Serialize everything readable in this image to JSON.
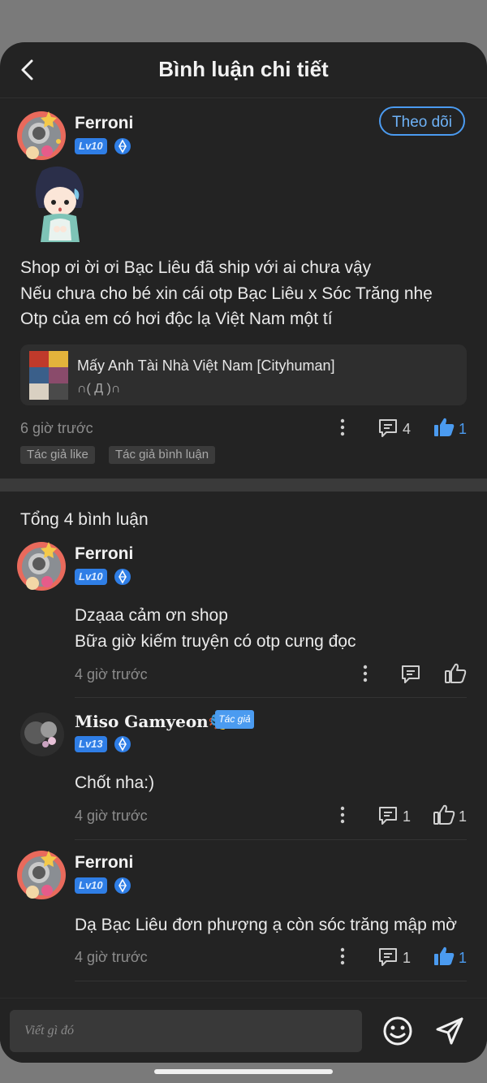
{
  "header": {
    "title": "Bình luận chi tiết"
  },
  "post": {
    "author": "Ferroni",
    "level": "Lv10",
    "follow_label": "Theo dõi",
    "lines": [
      "Shop ơi ời ơi Bạc Liêu đã ship với ai chưa vậy",
      "Nếu chưa cho bé xin cái otp Bạc Liêu x Sóc Trăng nhẹ",
      "Otp của em có hơi độc lạ Việt Nam một tí"
    ],
    "link": {
      "title": "Mấy Anh Tài Nhà Việt Nam [Cityhuman]",
      "subtitle": "∩( Д )∩"
    },
    "time": "6 giờ trước",
    "comment_count": "4",
    "like_count": "1",
    "tags": [
      "Tác giả like",
      "Tác giả bình luận"
    ]
  },
  "comments_header": "Tổng 4 bình luận",
  "comments": [
    {
      "author": "Ferroni",
      "level": "Lv10",
      "lines": [
        "Dzạaa cảm ơn shop",
        "Bữa giờ kiếm truyện có otp cưng đọc"
      ],
      "time": "4 giờ trước"
    },
    {
      "author": "Miso Gamyeon🎭",
      "level": "Lv13",
      "author_tag": "Tác giả",
      "lines": [
        "Chốt nha:)"
      ],
      "time": "4 giờ trước",
      "comment_count": "1",
      "like_count": "1"
    },
    {
      "author": "Ferroni",
      "level": "Lv10",
      "lines": [
        "Dạ Bạc Liêu đơn phượng ạ còn sóc trăng mập mờ"
      ],
      "time": "4 giờ trước",
      "comment_count": "1",
      "like_count": "1"
    }
  ],
  "composer": {
    "placeholder": "Viết gì đó"
  },
  "colors": {
    "accent": "#4b9bf0",
    "background": "#232323",
    "card": "#2e2e2e"
  }
}
